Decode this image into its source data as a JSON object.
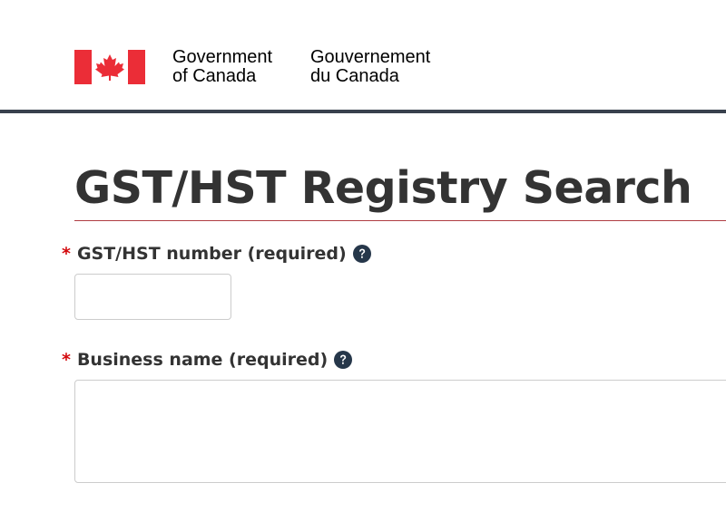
{
  "header": {
    "wordmark_en_line1": "Government",
    "wordmark_en_line2": "of Canada",
    "wordmark_fr_line1": "Gouvernement",
    "wordmark_fr_line2": "du Canada",
    "flag_icon": "canada-flag-icon",
    "flag_color": "#eb2d37",
    "rule_color": "#38414d"
  },
  "main": {
    "title": "GST/HST Registry Search",
    "title_rule_color": "#af3c43"
  },
  "form": {
    "required_marker": "*",
    "required_color": "#d3080c",
    "help_icon": "question-circle-icon",
    "help_icon_color": "#26374a",
    "gst_number": {
      "label": "GST/HST number (required)",
      "value": "",
      "placeholder": ""
    },
    "business_name": {
      "label": "Business name (required)",
      "value": "",
      "placeholder": ""
    }
  }
}
